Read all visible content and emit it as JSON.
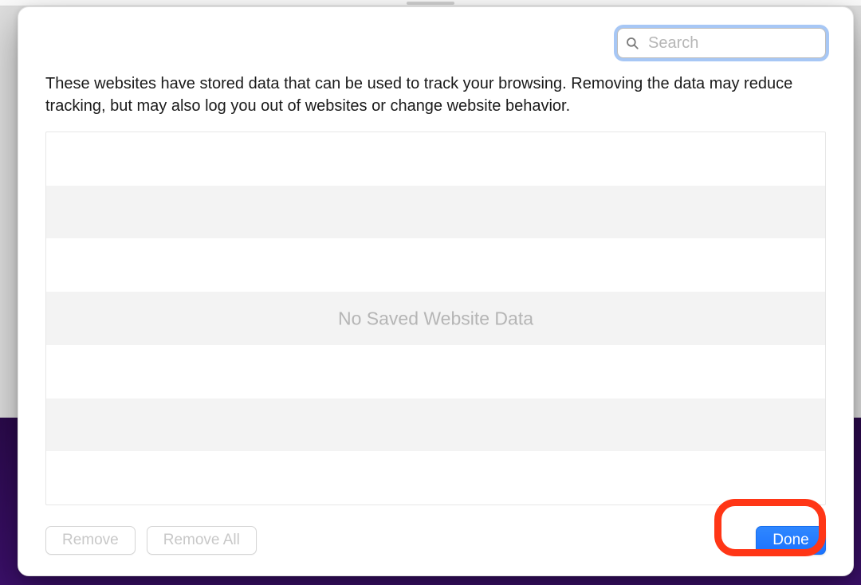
{
  "search": {
    "placeholder": "Search",
    "value": ""
  },
  "description": "These websites have stored data that can be used to track your browsing. Removing the data may reduce tracking, but may also log you out of websites or change website behavior.",
  "list": {
    "empty_message": "No Saved Website Data",
    "items": []
  },
  "buttons": {
    "remove": "Remove",
    "remove_all": "Remove All",
    "done": "Done"
  }
}
